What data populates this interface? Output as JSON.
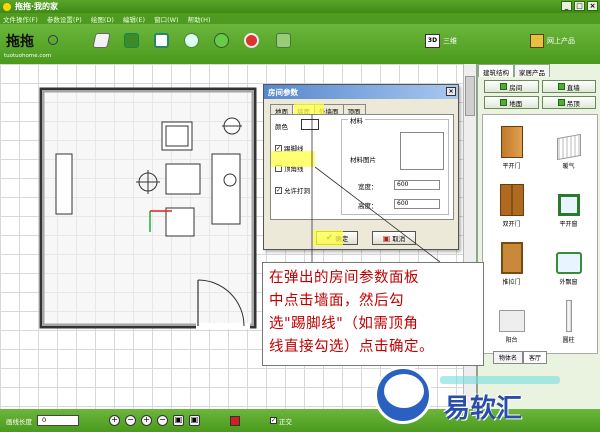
{
  "titlebar": {
    "title": "拖拖·我的家"
  },
  "menu": {
    "items": [
      "文件操作(F)",
      "参数设置(P)",
      "绘图(D)",
      "编辑(E)",
      "窗口(W)",
      "帮助(H)"
    ]
  },
  "toolbar": {
    "brand_text": "拖拖",
    "brand_url": "tuotuohome.com",
    "btn_3d_icon": "3D",
    "btn_3d_label": "三维",
    "btn_online_label": "网上产品"
  },
  "right_panel": {
    "tabs": [
      "建筑结构",
      "家居产品"
    ],
    "buttons": [
      "房间",
      "直墙",
      "地面",
      "吊顶"
    ],
    "items": [
      "平开门",
      "暖气",
      "双开门",
      "平开窗",
      "推拉门",
      "外飘窗",
      "阳台",
      "圆柱"
    ],
    "bottom_tabs": [
      "物体名",
      "客厅"
    ]
  },
  "status": {
    "wall_length_label": "画线长度",
    "wall_length_value": "0",
    "zoom_icons": [
      "+",
      "−",
      "+",
      "−",
      "▣",
      "▣"
    ],
    "ortho_label": "正交"
  },
  "dialog": {
    "title": "房间参数",
    "close": "×",
    "tabs": [
      "地面",
      "墙面",
      "外墙面",
      "顶面"
    ],
    "color_label": "颜色",
    "kick_line": "踢脚线",
    "top_line": "顶角线",
    "allow_hole": "允许打洞",
    "material_group": "材料",
    "material_pic": "材料图片",
    "width_label": "宽度：",
    "width_value": "600",
    "height_label": "高度：",
    "height_value": "600",
    "ok": "确定",
    "cancel": "取消"
  },
  "caption": {
    "lines": [
      "在弹出的房间参数面板",
      "中点击墙面，然后勾",
      "选\"踢脚线\"（如需顶角",
      "线直接勾选）点击确定。"
    ]
  },
  "watermark": {
    "text": "易软汇"
  },
  "colors": {
    "green": "#4f9b22",
    "caption_red": "#c00000",
    "highlight": "#ffff44"
  }
}
